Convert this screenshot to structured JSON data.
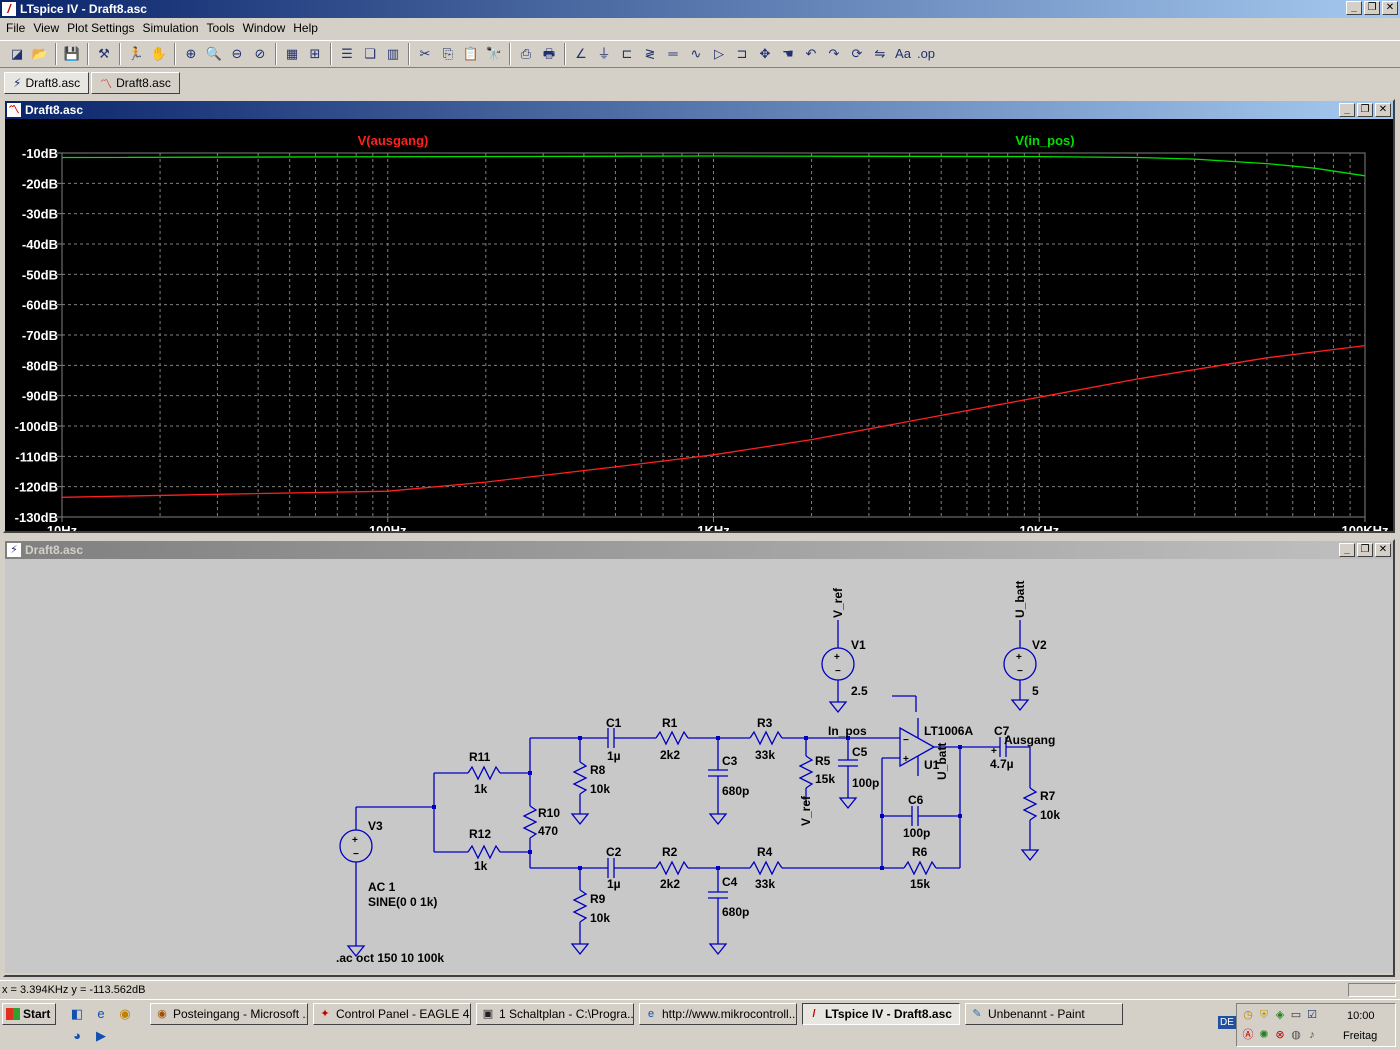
{
  "window": {
    "title": "LTspice IV - Draft8.asc"
  },
  "menu": [
    "File",
    "View",
    "Plot Settings",
    "Simulation",
    "Tools",
    "Window",
    "Help"
  ],
  "toolbar": [
    "new-schematic-icon",
    "open-icon",
    "save-icon",
    "control-panel-icon",
    "run-icon",
    "halt-icon",
    "zoom-in-icon",
    "zoom-area-icon",
    "zoom-out-icon",
    "zoom-cancel-icon",
    "autorange-icon",
    "grid-icon",
    "tile-horizontal-icon",
    "cascade-icon",
    "tile-vertical-icon",
    "cut-icon",
    "copy-icon",
    "paste-icon",
    "find-icon",
    "print-setup-icon",
    "print-icon",
    "wire-icon",
    "ground-icon",
    "label-icon",
    "resistor-icon",
    "capacitor-icon",
    "inductor-icon",
    "diode-icon",
    "component-icon",
    "move-icon",
    "drag-icon",
    "undo-icon",
    "redo-icon",
    "rotate-icon",
    "mirror-icon",
    "text-icon",
    "spice-directive-icon"
  ],
  "tabs": [
    {
      "label": "Draft8.asc",
      "icon": "schematic-icon"
    },
    {
      "label": "Draft8.asc",
      "icon": "waveform-icon"
    }
  ],
  "plot_window": {
    "title": "Draft8.asc"
  },
  "schematic_window": {
    "title": "Draft8.asc"
  },
  "chart_data": {
    "type": "line",
    "xscale": "log",
    "xlim": [
      10,
      100000
    ],
    "ylim": [
      -130,
      -10
    ],
    "grid": true,
    "background": "#000000",
    "y_ticks": [
      "-10dB",
      "-20dB",
      "-30dB",
      "-40dB",
      "-50dB",
      "-60dB",
      "-70dB",
      "-80dB",
      "-90dB",
      "-100dB",
      "-110dB",
      "-120dB",
      "-130dB"
    ],
    "y_tick_values": [
      -10,
      -20,
      -30,
      -40,
      -50,
      -60,
      -70,
      -80,
      -90,
      -100,
      -110,
      -120,
      -130
    ],
    "x_ticks": [
      "10Hz",
      "100Hz",
      "1KHz",
      "10KHz",
      "100KHz"
    ],
    "x_tick_values": [
      10,
      100,
      1000,
      10000,
      100000
    ],
    "series": [
      {
        "name": "V(ausgang)",
        "color": "#ff2020",
        "x": [
          10,
          30,
          100,
          200,
          500,
          1000,
          2000,
          5000,
          10000,
          20000,
          50000,
          100000
        ],
        "y": [
          -123.5,
          -122.5,
          -121.5,
          -118.5,
          -113.5,
          -109.5,
          -104.5,
          -96.5,
          -90.5,
          -84.5,
          -77.5,
          -73.5
        ]
      },
      {
        "name": "V(in_pos)",
        "color": "#00e000",
        "x": [
          10,
          1000,
          10000,
          20000,
          30000,
          50000,
          70000,
          100000
        ],
        "y": [
          -11.5,
          -11.0,
          -11.2,
          -11.5,
          -12.0,
          -13.5,
          -15.0,
          -17.5
        ]
      }
    ]
  },
  "schematic": {
    "labels": {
      "v1": "V1",
      "v1_val": "2.5",
      "v1_net": "V_ref",
      "v2": "V2",
      "v2_val": "5",
      "v2_net": "U_batt",
      "v3": "V3",
      "v3_val1": "AC 1",
      "v3_val2": "SINE(0 0 1k)",
      "directive": ".ac oct 150 10 100k",
      "r11": "R11",
      "r11_val": "1k",
      "r12": "R12",
      "r12_val": "1k",
      "r10": "R10",
      "r10_val": "470",
      "r8": "R8",
      "r8_val": "10k",
      "r9": "R9",
      "r9_val": "10k",
      "c1": "C1",
      "c1_val": "1µ",
      "c2": "C2",
      "c2_val": "1µ",
      "r1": "R1",
      "r1_val": "2k2",
      "r2": "R2",
      "r2_val": "2k2",
      "c3": "C3",
      "c3_val": "680p",
      "c4": "C4",
      "c4_val": "680p",
      "r3": "R3",
      "r3_val": "33k",
      "r4": "R4",
      "r4_val": "33k",
      "r5": "R5",
      "r5_val": "15k",
      "r5_net": "V_ref",
      "c5": "C5",
      "c5_val": "100p",
      "in_pos": "In_pos",
      "u1": "U1",
      "u1_part": "LT1006A",
      "u1_net": "U_batt",
      "c6": "C6",
      "c6_val": "100p",
      "r6": "R6",
      "r6_val": "15k",
      "c7": "C7",
      "c7_val": "4.7µ",
      "ausgang": "Ausgang",
      "r7": "R7",
      "r7_val": "10k"
    }
  },
  "status": {
    "cursor": "x = 3.394KHz    y = -113.562dB"
  },
  "taskbar": {
    "start": "Start",
    "tasks": [
      {
        "label": "Posteingang - Microsoft ...",
        "active": false
      },
      {
        "label": "Control Panel - EAGLE 4....",
        "active": false
      },
      {
        "label": "1 Schaltplan - C:\\Progra...",
        "active": false
      },
      {
        "label": "http://www.mikrocontroll...",
        "active": false
      },
      {
        "label": "LTspice IV - Draft8.asc",
        "active": true
      },
      {
        "label": "Unbenannt - Paint",
        "active": false
      }
    ],
    "lang": "DE",
    "time": "10:00",
    "day": "Freitag"
  },
  "colors": {
    "title_active": "#0a246a",
    "wire": "#0000c0",
    "ltspice_gray": "#c8c8c8"
  }
}
